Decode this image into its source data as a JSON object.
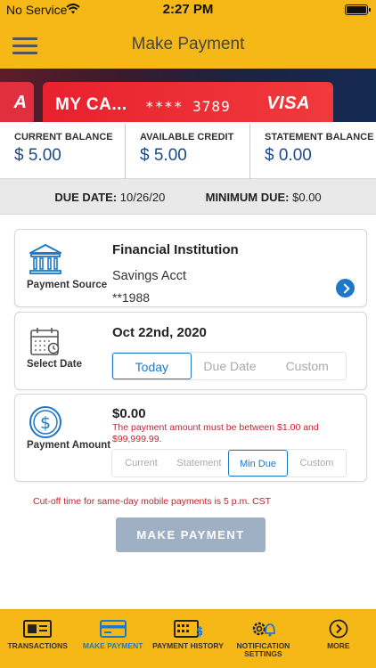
{
  "status_bar": {
    "carrier": "No Service",
    "time": "2:27 PM"
  },
  "header": {
    "title": "Make Payment"
  },
  "cards": {
    "prev_fragment": "A",
    "name": "MY CA...",
    "number": "**** 3789",
    "brand": "VISA"
  },
  "balances": [
    {
      "label": "CURRENT BALANCE",
      "value": "$ 5.00"
    },
    {
      "label": "AVAILABLE CREDIT",
      "value": "$ 5.00"
    },
    {
      "label": "STATEMENT BALANCE",
      "value": "$ 0.00"
    }
  ],
  "due": {
    "due_date_label": "DUE DATE:",
    "due_date_value": "10/26/20",
    "min_due_label": "MINIMUM DUE:",
    "min_due_value": "$0.00"
  },
  "payment_source": {
    "label": "Payment Source",
    "icon": "bank-icon",
    "institution": "Financial Institution",
    "account_type": "Savings Acct",
    "account_number": "**1988"
  },
  "select_date": {
    "label": "Select Date",
    "icon": "calendar-icon",
    "value": "Oct 22nd, 2020",
    "options": [
      "Today",
      "Due Date",
      "Custom"
    ],
    "selected": "Today"
  },
  "payment_amount": {
    "label": "Payment Amount",
    "icon": "dollar-coin-icon",
    "value": "$0.00",
    "error": "The payment amount must be between $1.00 and $99,999.99.",
    "options": [
      "Current",
      "Statement",
      "Min Due",
      "Custom"
    ],
    "selected": "Min Due"
  },
  "cutoff_notice": "Cut-off time for same-day mobile payments is 5 p.m. CST",
  "make_payment_button": "MAKE PAYMENT",
  "bottom_nav": [
    {
      "label": "TRANSACTIONS",
      "icon": "transactions-icon"
    },
    {
      "label": "MAKE PAYMENT",
      "icon": "card-payment-icon",
      "active": true
    },
    {
      "label": "PAYMENT HISTORY",
      "icon": "payment-history-icon"
    },
    {
      "label": "NOTIFICATION SETTINGS",
      "icon": "gear-bell-icon"
    },
    {
      "label": "MORE",
      "icon": "chevron-right-icon"
    }
  ],
  "colors": {
    "accent_yellow": "#f6b817",
    "link_blue": "#1e78c7",
    "error_red": "#cc1f2e",
    "card_red": "#e8212f"
  }
}
